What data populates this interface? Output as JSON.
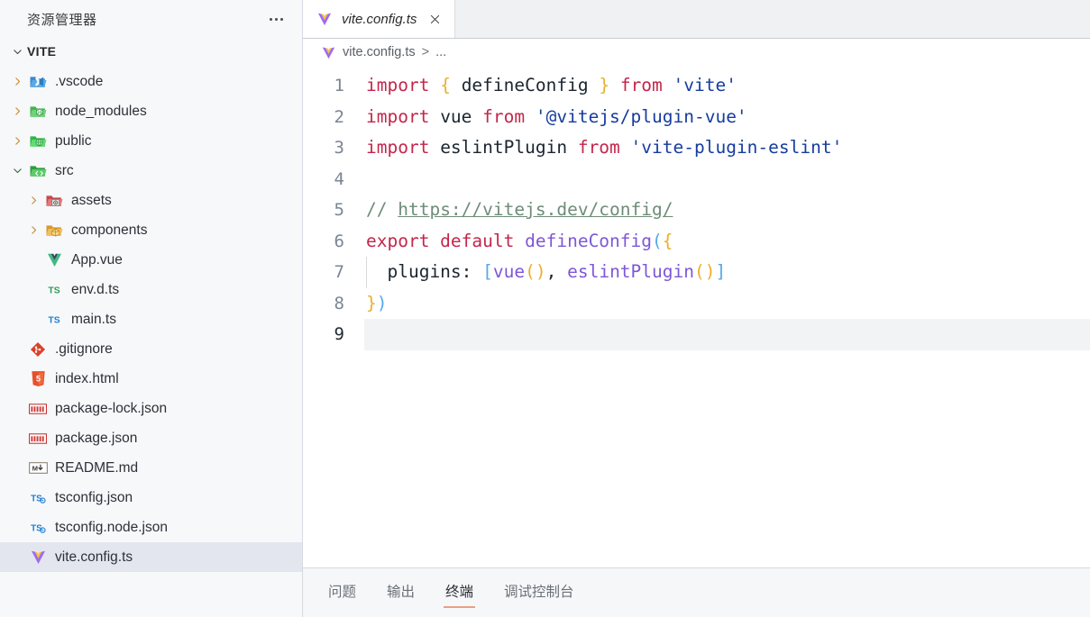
{
  "sidebar": {
    "title": "资源管理器",
    "more_icon": "ellipsis-icon",
    "section": {
      "label": "VITE",
      "expanded": true
    },
    "tree": [
      {
        "label": ".vscode",
        "icon": "vscode-folder-icon",
        "type": "folder",
        "depth": 1,
        "expanded": false
      },
      {
        "label": "node_modules",
        "icon": "node-folder-icon",
        "type": "folder",
        "depth": 1,
        "expanded": false
      },
      {
        "label": "public",
        "icon": "public-folder-icon",
        "type": "folder",
        "depth": 1,
        "expanded": false
      },
      {
        "label": "src",
        "icon": "src-folder-icon",
        "type": "folder",
        "depth": 1,
        "expanded": true
      },
      {
        "label": "assets",
        "icon": "assets-folder-icon",
        "type": "folder",
        "depth": 2,
        "expanded": false
      },
      {
        "label": "components",
        "icon": "components-folder-icon",
        "type": "folder",
        "depth": 2,
        "expanded": false
      },
      {
        "label": "App.vue",
        "icon": "vue-file-icon",
        "type": "file",
        "depth": 2
      },
      {
        "label": "env.d.ts",
        "icon": "ts-def-file-icon",
        "type": "file",
        "depth": 2
      },
      {
        "label": "main.ts",
        "icon": "ts-file-icon",
        "type": "file",
        "depth": 2
      },
      {
        "label": ".gitignore",
        "icon": "git-file-icon",
        "type": "file",
        "depth": 1
      },
      {
        "label": "index.html",
        "icon": "html-file-icon",
        "type": "file",
        "depth": 1
      },
      {
        "label": "package-lock.json",
        "icon": "npm-file-icon",
        "type": "file",
        "depth": 1
      },
      {
        "label": "package.json",
        "icon": "npm-file-icon",
        "type": "file",
        "depth": 1
      },
      {
        "label": "README.md",
        "icon": "markdown-file-icon",
        "type": "file",
        "depth": 1
      },
      {
        "label": "tsconfig.json",
        "icon": "tsconfig-file-icon",
        "type": "file",
        "depth": 1
      },
      {
        "label": "tsconfig.node.json",
        "icon": "tsconfig-file-icon",
        "type": "file",
        "depth": 1
      },
      {
        "label": "vite.config.ts",
        "icon": "vite-file-icon",
        "type": "file",
        "depth": 1,
        "selected": true
      }
    ]
  },
  "editor": {
    "tabs": [
      {
        "label": "vite.config.ts",
        "icon": "vite-file-icon",
        "italic": true,
        "active": true,
        "close_icon": "close-icon"
      }
    ],
    "breadcrumb": {
      "icon": "vite-file-icon",
      "file": "vite.config.ts",
      "separator": ">",
      "more": "..."
    },
    "active_line": 9,
    "lines": [
      {
        "n": 1,
        "tokens": [
          {
            "t": "import",
            "c": "kw"
          },
          {
            "t": " ",
            "c": "var"
          },
          {
            "t": "{",
            "c": "brace"
          },
          {
            "t": " defineConfig ",
            "c": "var"
          },
          {
            "t": "}",
            "c": "brace"
          },
          {
            "t": " ",
            "c": "var"
          },
          {
            "t": "from",
            "c": "kw"
          },
          {
            "t": " ",
            "c": "var"
          },
          {
            "t": "'vite'",
            "c": "str"
          }
        ]
      },
      {
        "n": 2,
        "tokens": [
          {
            "t": "import",
            "c": "kw"
          },
          {
            "t": " vue ",
            "c": "var"
          },
          {
            "t": "from",
            "c": "kw"
          },
          {
            "t": " ",
            "c": "var"
          },
          {
            "t": "'@vitejs/plugin-vue'",
            "c": "str"
          }
        ]
      },
      {
        "n": 3,
        "tokens": [
          {
            "t": "import",
            "c": "kw"
          },
          {
            "t": " eslintPlugin ",
            "c": "var"
          },
          {
            "t": "from",
            "c": "kw"
          },
          {
            "t": " ",
            "c": "var"
          },
          {
            "t": "'vite-plugin-eslint'",
            "c": "str"
          }
        ]
      },
      {
        "n": 4,
        "tokens": []
      },
      {
        "n": 5,
        "tokens": [
          {
            "t": "// ",
            "c": "cm"
          },
          {
            "t": "https://vitejs.dev/config/",
            "c": "link"
          }
        ]
      },
      {
        "n": 6,
        "tokens": [
          {
            "t": "export default",
            "c": "kw"
          },
          {
            "t": " ",
            "c": "var"
          },
          {
            "t": "defineConfig",
            "c": "fn"
          },
          {
            "t": "(",
            "c": "brk"
          },
          {
            "t": "{",
            "c": "brace"
          }
        ]
      },
      {
        "n": 7,
        "indent": true,
        "tokens": [
          {
            "t": "  plugins",
            "c": "prop"
          },
          {
            "t": ": ",
            "c": "var"
          },
          {
            "t": "[",
            "c": "brk"
          },
          {
            "t": "vue",
            "c": "fn"
          },
          {
            "t": "()",
            "c": "brace"
          },
          {
            "t": ", ",
            "c": "var"
          },
          {
            "t": "eslintPlugin",
            "c": "fn"
          },
          {
            "t": "()",
            "c": "brace"
          },
          {
            "t": "]",
            "c": "brk"
          }
        ]
      },
      {
        "n": 8,
        "tokens": [
          {
            "t": "}",
            "c": "brace"
          },
          {
            "t": ")",
            "c": "brk"
          }
        ]
      },
      {
        "n": 9,
        "tokens": []
      }
    ]
  },
  "panel": {
    "tabs": [
      {
        "label": "问题",
        "active": false
      },
      {
        "label": "输出",
        "active": false
      },
      {
        "label": "终端",
        "active": true
      },
      {
        "label": "调试控制台",
        "active": false
      }
    ]
  },
  "colors": {
    "sidebar_bg": "#F7F8FA",
    "selection_bg": "#E3E6EF",
    "tabbar_bg": "#F0F1F3",
    "panel_bg": "#F6F7F9",
    "active_tab_underline": "#E8A083",
    "keyword": "#C3264B",
    "string": "#163C9E",
    "function": "#7E57D6",
    "comment": "#6E8C78",
    "brace": "#E8B12E",
    "bracket": "#57A8E8"
  }
}
